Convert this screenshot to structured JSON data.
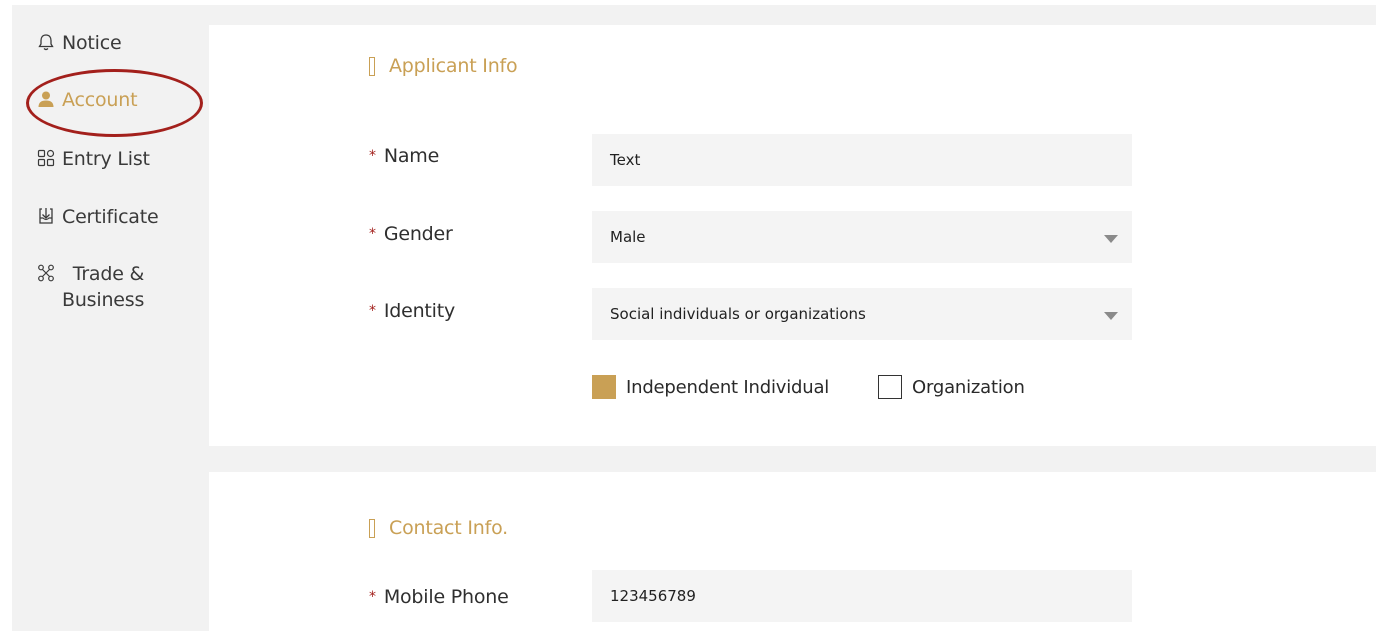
{
  "sidebar": {
    "items": [
      {
        "label": "Notice",
        "icon": "bell-icon"
      },
      {
        "label": "Account",
        "icon": "user-icon",
        "active": true
      },
      {
        "label": "Entry List",
        "icon": "grid-icon"
      },
      {
        "label": "Certificate",
        "icon": "download-box-icon"
      },
      {
        "label": "Trade &",
        "label2": "Business",
        "icon": "network-icon"
      }
    ]
  },
  "colors": {
    "accent": "#c9a055",
    "required": "#a3201c",
    "highlight_ring": "#a3201c",
    "field_bg": "#f4f4f4",
    "page_bg": "#f2f2f2"
  },
  "applicant": {
    "title": "Applicant Info",
    "name_label": "Name",
    "name_value": "Text",
    "gender_label": "Gender",
    "gender_value": "Male",
    "identity_label": "Identity",
    "identity_value": "Social individuals or organizations",
    "options": [
      {
        "label": "Independent Individual",
        "checked": true
      },
      {
        "label": "Organization",
        "checked": false
      }
    ],
    "required_mark": "*"
  },
  "contact": {
    "title": "Contact Info.",
    "phone_label": "Mobile Phone",
    "phone_value": "123456789"
  }
}
